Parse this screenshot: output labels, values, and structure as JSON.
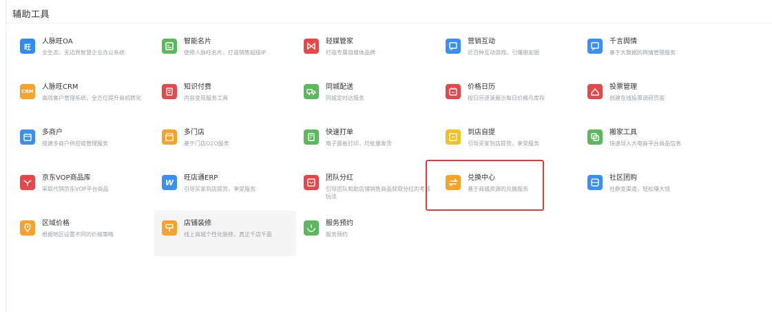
{
  "section_title": "辅助工具",
  "tools": [
    {
      "name": "人脉旺OA",
      "desc": "全生态、无边界智慧企业办公系统",
      "icon": "oa-icon",
      "color": "#2d8cf0"
    },
    {
      "name": "智能名片",
      "desc": "使用人脉旺名片，打造销售超级IP",
      "icon": "card-icon",
      "color": "#5cb85c"
    },
    {
      "name": "轻媒管家",
      "desc": "打造专属自媒体品牌",
      "icon": "media-icon",
      "color": "#e5474b"
    },
    {
      "name": "营销互动",
      "desc": "近百种互动游戏，引爆朋友圈",
      "icon": "chat-icon",
      "color": "#3b8ff3"
    },
    {
      "name": "千言舆情",
      "desc": "基于大数据的舆情管理服务",
      "icon": "chat-icon",
      "color": "#3b8ff3"
    },
    {
      "name": "人脉旺CRM",
      "desc": "高效客户管理系统，全方位提升商机转化",
      "icon": "crm-icon",
      "color": "#f7a22a"
    },
    {
      "name": "知识付费",
      "desc": "内容变现服务工具",
      "icon": "book-icon",
      "color": "#e5474b"
    },
    {
      "name": "同城配送",
      "desc": "同城定时达服务",
      "icon": "truck-icon",
      "color": "#5cb85c"
    },
    {
      "name": "价格日历",
      "desc": "按日历逐渐展示每日价格与库存",
      "icon": "calendar-icon",
      "color": "#e5474b"
    },
    {
      "name": "投票管理",
      "desc": "创建在线投票调研页面",
      "icon": "vote-icon",
      "color": "#e5474b"
    },
    {
      "name": "多商户",
      "desc": "搭建多商户供应链管理服务",
      "icon": "store-icon",
      "color": "#3b8ff3"
    },
    {
      "name": "多门店",
      "desc": "基于门店O2O服务",
      "icon": "shop-icon",
      "color": "#f7a22a"
    },
    {
      "name": "快速打单",
      "desc": "电子面板打印，可批量发货",
      "icon": "print-icon",
      "color": "#5cb85c"
    },
    {
      "name": "到店自提",
      "desc": "引导买家到店提货，享受服务",
      "icon": "pickup-icon",
      "color": "#f5c023"
    },
    {
      "name": "搬家工具",
      "desc": "快速导入大电商平台商品信息",
      "icon": "move-icon",
      "color": "#5cb85c"
    },
    {
      "name": "京东VOP商品库",
      "desc": "采取代销京东VOP平台商品",
      "icon": "jd-icon",
      "color": "#e5474b"
    },
    {
      "name": "旺店通ERP",
      "desc": "引导买家到店提货，享受服务",
      "icon": "erp-icon",
      "color": "#3b8ff3"
    },
    {
      "name": "团队分红",
      "desc": "引导团队和助店铺销售商品获取分红的考核玩法",
      "icon": "bonus-icon",
      "color": "#e5474b"
    },
    {
      "name": "兑换中心",
      "desc": "基于商城资源的兑换服务",
      "icon": "exchange-icon",
      "color": "#f7a22a"
    },
    {
      "name": "社区团购",
      "desc": "社群变渠道，轻松赚大钱",
      "icon": "group-icon",
      "color": "#3b8ff3"
    },
    {
      "name": "区域价格",
      "desc": "根据地区设置不同的价格策略",
      "icon": "location-icon",
      "color": "#f7a22a"
    },
    {
      "name": "店铺装修",
      "desc": "线上商城个性化装修，真正千店千面",
      "icon": "brush-icon",
      "color": "#f7a22a"
    },
    {
      "name": "服务预约",
      "desc": "服务预约",
      "icon": "appointment-icon",
      "color": "#5cb85c"
    }
  ]
}
